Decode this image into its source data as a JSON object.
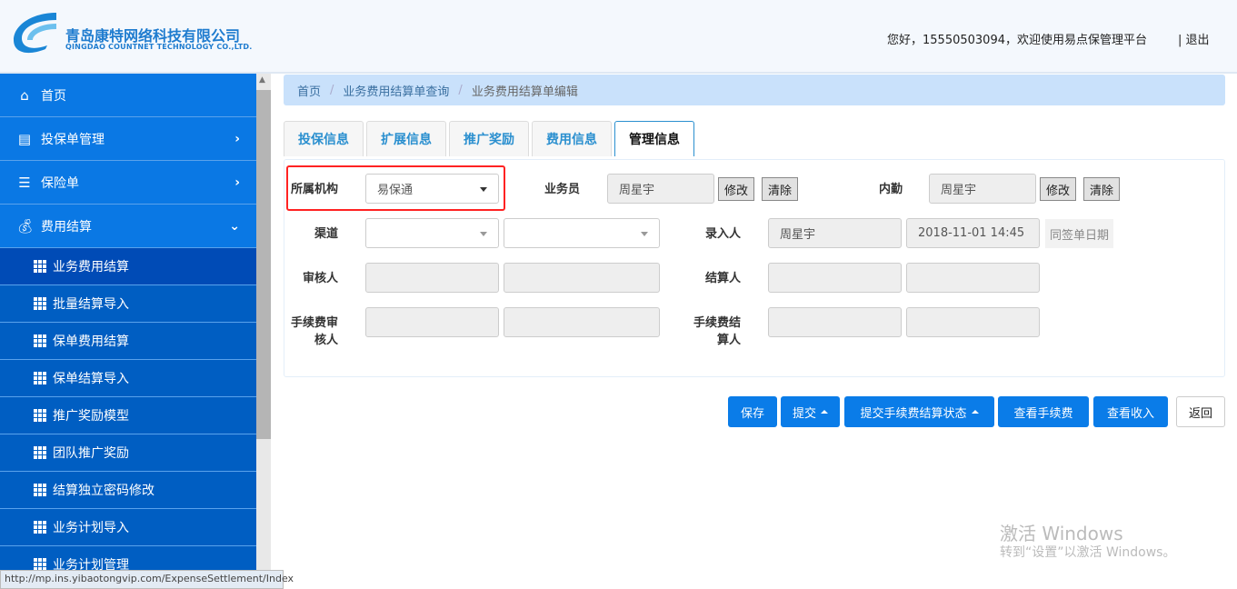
{
  "header": {
    "company_cn": "青岛康特网络科技有限公司",
    "company_en": "QINGDAO COUNTNET TECHNOLOGY CO.,LTD.",
    "greeting": "您好，15550503094，欢迎使用易点保管理平台",
    "logout": "| 退出"
  },
  "sidebar": {
    "menus": [
      {
        "label": "首页",
        "icon": "home-icon"
      },
      {
        "label": "投保单管理",
        "icon": "document-icon"
      },
      {
        "label": "保险单",
        "icon": "list-icon"
      },
      {
        "label": "费用结算",
        "icon": "money-bag-icon"
      }
    ],
    "subitems": [
      "业务费用结算",
      "批量结算导入",
      "保单费用结算",
      "保单结算导入",
      "推广奖励模型",
      "团队推广奖励",
      "结算独立密码修改",
      "业务计划导入",
      "业务计划管理"
    ]
  },
  "status_url": "http://mp.ins.yibaotongvip.com/ExpenseSettlement/Index",
  "breadcrumb": [
    "首页",
    "业务费用结算单查询",
    "业务费用结算单编辑"
  ],
  "tabs": [
    "投保信息",
    "扩展信息",
    "推广奖励",
    "费用信息",
    "管理信息"
  ],
  "form": {
    "org_label": "所属机构",
    "org_value": "易保通",
    "salesman_label": "业务员",
    "salesman_value": "周星宇",
    "internal_label": "内勤",
    "internal_value": "周星宇",
    "modify": "修改",
    "clear": "清除",
    "channel_label": "渠道",
    "entry_label": "录入人",
    "entry_value": "周星宇",
    "entry_time": "2018-11-01 14:45",
    "same_date": "同签单日期",
    "reviewer_label": "审核人",
    "settler_label": "结算人",
    "fee_reviewer_label": "手续费审核人",
    "fee_settler_label": "手续费结算人"
  },
  "buttons": {
    "save": "保存",
    "submit": "提交",
    "submit_fee_status": "提交手续费结算状态",
    "view_fee": "查看手续费",
    "view_income": "查看收入",
    "back": "返回"
  },
  "watermark": {
    "title": "激活 Windows",
    "subtitle": "转到“设置”以激活 Windows。"
  }
}
